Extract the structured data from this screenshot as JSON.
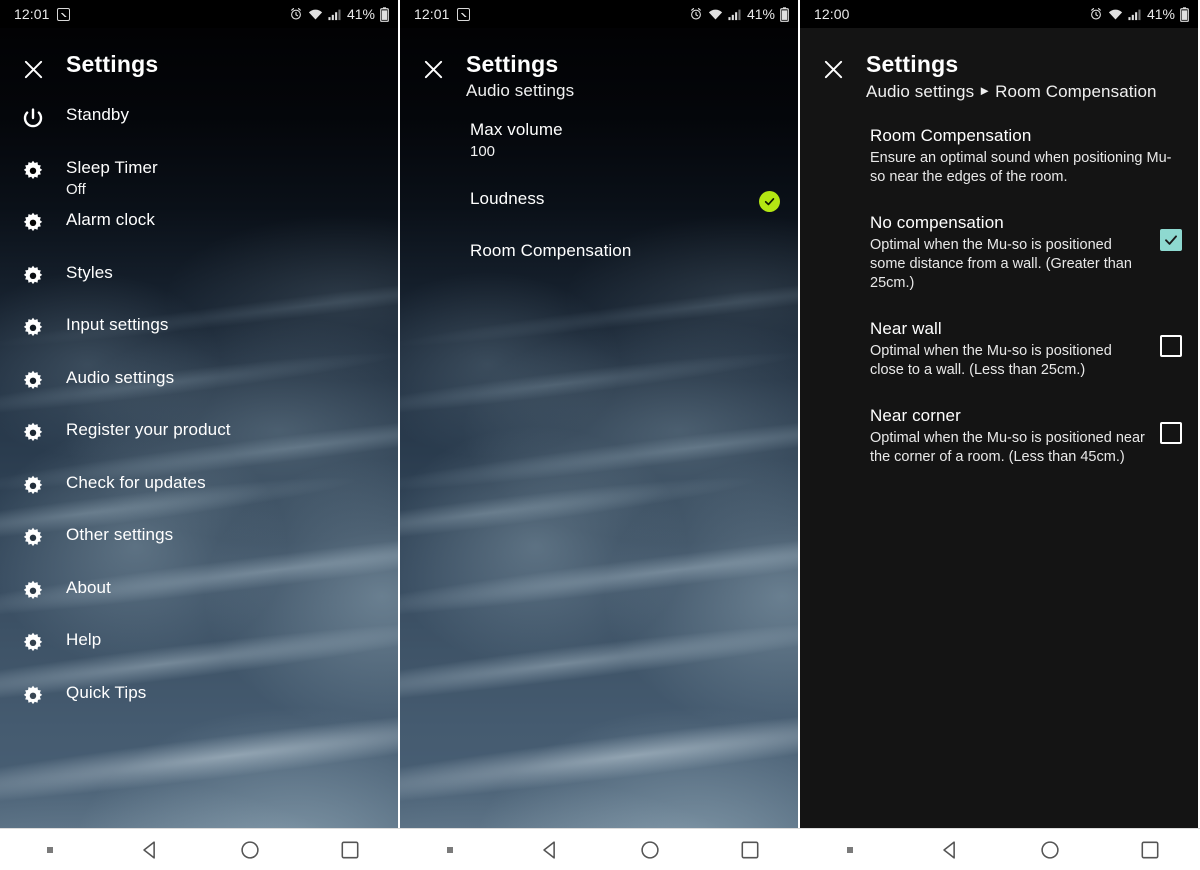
{
  "screens": [
    {
      "status_bar": {
        "time": "12:01",
        "battery_percent": "41%",
        "icons": [
          "screenshot-image-icon",
          "alarm-icon",
          "wifi-icon",
          "cellular-signal-icon",
          "battery-icon"
        ]
      },
      "header": {
        "title": "Settings",
        "subtitle": "",
        "close_icon": "close-icon"
      },
      "menu_items": [
        {
          "icon": "power-icon",
          "label": "Standby",
          "value": ""
        },
        {
          "icon": "gear-icon",
          "label": "Sleep Timer",
          "value": "Off"
        },
        {
          "icon": "gear-icon",
          "label": "Alarm clock",
          "value": ""
        },
        {
          "icon": "gear-icon",
          "label": "Styles",
          "value": ""
        },
        {
          "icon": "gear-icon",
          "label": "Input settings",
          "value": ""
        },
        {
          "icon": "gear-icon",
          "label": "Audio settings",
          "value": ""
        },
        {
          "icon": "gear-icon",
          "label": "Register your product",
          "value": ""
        },
        {
          "icon": "gear-icon",
          "label": "Check for updates",
          "value": ""
        },
        {
          "icon": "gear-icon",
          "label": "Other settings",
          "value": ""
        },
        {
          "icon": "gear-icon",
          "label": "About",
          "value": ""
        },
        {
          "icon": "gear-icon",
          "label": "Help",
          "value": ""
        },
        {
          "icon": "gear-icon",
          "label": "Quick Tips",
          "value": ""
        }
      ]
    },
    {
      "status_bar": {
        "time": "12:01",
        "battery_percent": "41%",
        "icons": [
          "screenshot-image-icon",
          "alarm-icon",
          "wifi-icon",
          "cellular-signal-icon",
          "battery-icon"
        ]
      },
      "header": {
        "title": "Settings",
        "subtitle": "Audio settings",
        "close_icon": "close-icon"
      },
      "rows": [
        {
          "label": "Max volume",
          "value": "100",
          "checked": false
        },
        {
          "label": "Loudness",
          "value": "",
          "checked": true
        },
        {
          "label": "Room Compensation",
          "value": "",
          "checked": false
        }
      ]
    },
    {
      "status_bar": {
        "time": "12:00",
        "battery_percent": "41%",
        "icons": [
          "alarm-icon",
          "wifi-icon",
          "cellular-signal-icon",
          "battery-icon"
        ]
      },
      "header": {
        "title": "Settings",
        "crumb_parent": "Audio settings",
        "crumb_sep": "►",
        "crumb_current": "Room Compensation",
        "close_icon": "close-icon"
      },
      "section": {
        "title": "Room Compensation",
        "description": "Ensure an optimal sound when positioning Mu-so near the edges of the room."
      },
      "options": [
        {
          "title": "No compensation",
          "description": "Optimal when the Mu-so is positioned some distance from a wall. (Greater than 25cm.)",
          "checked": true
        },
        {
          "title": "Near wall",
          "description": "Optimal when the Mu-so is positioned close to a wall. (Less than 25cm.)",
          "checked": false
        },
        {
          "title": "Near corner",
          "description": "Optimal when the Mu-so is positioned near the corner of a room. (Less than 45cm.)",
          "checked": false
        }
      ]
    }
  ],
  "nav_bar": {
    "items": [
      "indicator-dot",
      "back-icon",
      "home-icon",
      "recents-icon"
    ]
  },
  "colors": {
    "accent_green": "#b3e713",
    "accent_teal": "#8ed9d0",
    "panel_dark": "#141414",
    "status_bar": "#000000",
    "nav_bar": "#ffffff"
  }
}
